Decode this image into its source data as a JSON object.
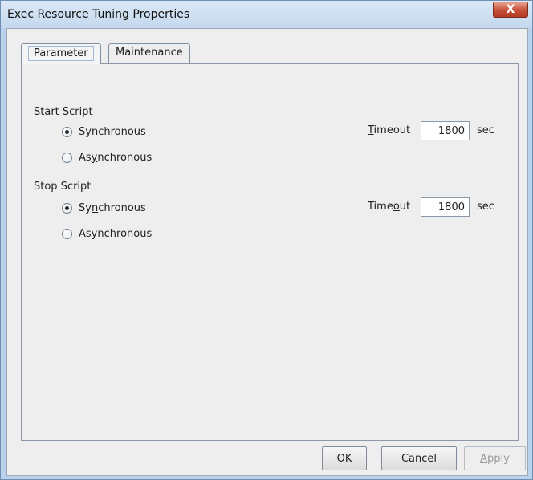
{
  "window": {
    "title": "Exec Resource Tuning Properties",
    "close_glyph": "X"
  },
  "tabs": [
    {
      "label": "Parameter",
      "active": true
    },
    {
      "label": "Maintenance",
      "active": false
    }
  ],
  "start_script": {
    "heading": "Start Script",
    "sync": {
      "pre": "",
      "mnemonic": "S",
      "post": "ynchronous",
      "checked": true
    },
    "async": {
      "pre": "As",
      "mnemonic": "y",
      "post": "nchronous",
      "checked": false
    },
    "timeout": {
      "pre": "",
      "mnemonic": "T",
      "post": "imeout",
      "value": "1800",
      "unit": "sec"
    }
  },
  "stop_script": {
    "heading": "Stop Script",
    "sync": {
      "pre": "Sy",
      "mnemonic": "n",
      "post": "chronous",
      "checked": true
    },
    "async": {
      "pre": "Asyn",
      "mnemonic": "c",
      "post": "hronous",
      "checked": false
    },
    "timeout": {
      "pre": "Time",
      "mnemonic": "o",
      "post": "ut",
      "value": "1800",
      "unit": "sec"
    }
  },
  "buttons": {
    "ok": "OK",
    "cancel": "Cancel",
    "apply": {
      "mnemonic": "A",
      "post": "pply",
      "enabled": false
    }
  }
}
